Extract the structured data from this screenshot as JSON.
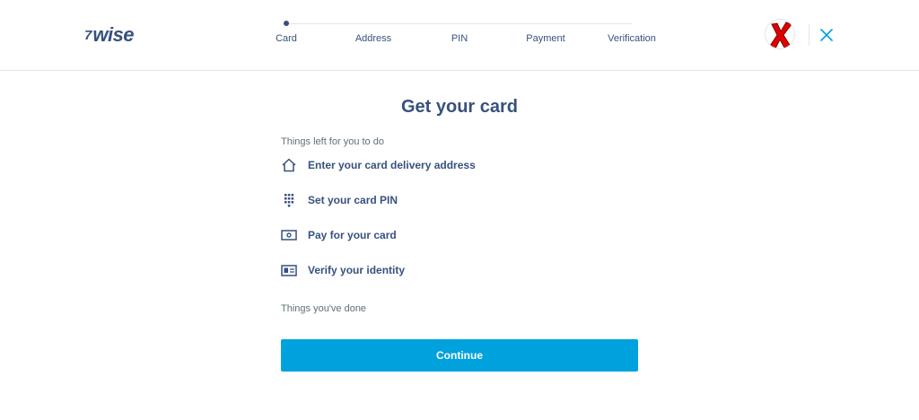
{
  "header": {
    "logo_flag": "7",
    "logo_text": "wise",
    "steps": [
      {
        "label": "Card",
        "active": true
      },
      {
        "label": "Address",
        "active": false
      },
      {
        "label": "PIN",
        "active": false
      },
      {
        "label": "Payment",
        "active": false
      },
      {
        "label": "Verification",
        "active": false
      }
    ],
    "avatar_icon": "red-x-mark-icon",
    "close_icon": "close-icon"
  },
  "main": {
    "title": "Get your card",
    "todo_heading": "Things left for you to do",
    "todo_items": [
      {
        "label": "Enter your card delivery address",
        "icon": "home-icon"
      },
      {
        "label": "Set your card PIN",
        "icon": "keypad-icon"
      },
      {
        "label": "Pay for your card",
        "icon": "banknote-icon"
      },
      {
        "label": "Verify your identity",
        "icon": "id-card-icon"
      }
    ],
    "done_heading": "Things you've done",
    "continue_label": "Continue"
  },
  "colors": {
    "navy": "#37517e",
    "accent": "#00a2dd",
    "muted": "#5d7079",
    "border": "#e2e6e8",
    "avatar_mark": "#e00000"
  }
}
